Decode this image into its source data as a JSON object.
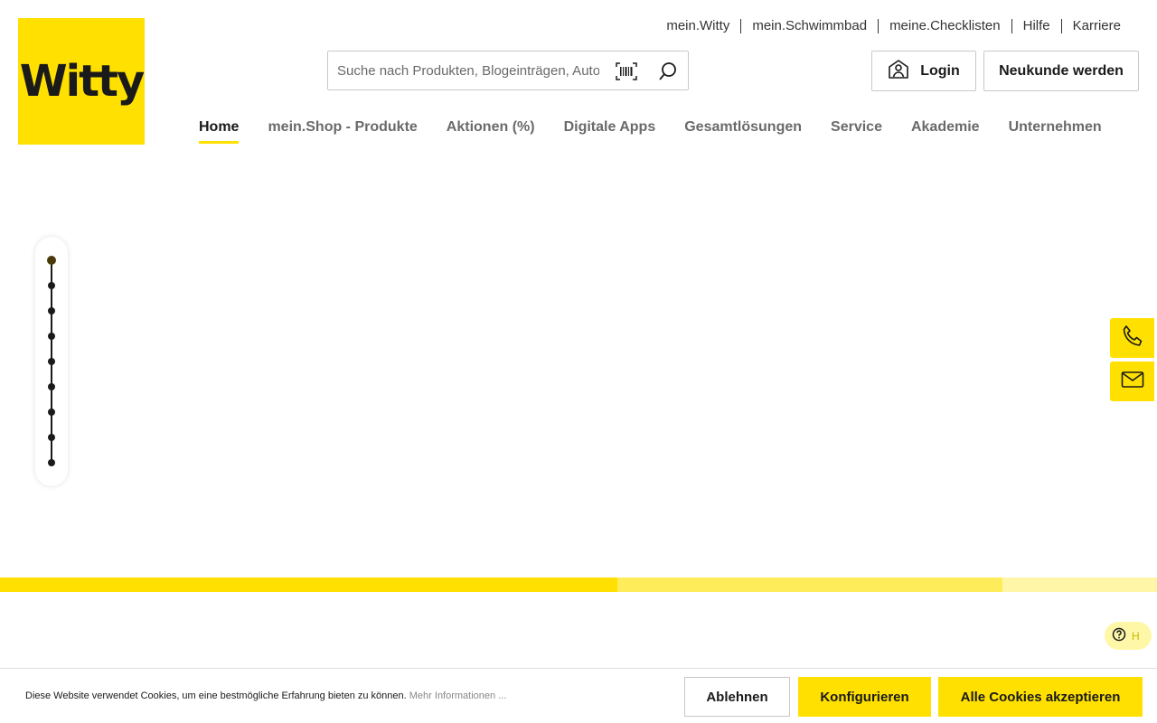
{
  "brand": {
    "logo_text": "Witty",
    "accent_color": "#ffe000"
  },
  "top_links": [
    "mein.Witty",
    "mein.Schwimmbad",
    "meine.Checklisten",
    "Hilfe",
    "Karriere"
  ],
  "search": {
    "placeholder": "Suche nach Produkten, Blogeinträgen, Auto",
    "barcode_icon": "barcode-icon",
    "search_icon": "search-icon"
  },
  "account": {
    "login_label": "Login",
    "register_label": "Neukunde werden",
    "login_icon": "user-house-icon"
  },
  "main_nav": {
    "items": [
      "Home",
      "mein.Shop - Produkte",
      "Aktionen (%)",
      "Digitale Apps",
      "Gesamtlösungen",
      "Service",
      "Akademie",
      "Unternehmen"
    ],
    "active_index": 0
  },
  "slider": {
    "dot_count": 9,
    "active_index": 0
  },
  "side_contacts": [
    "phone-icon",
    "mail-icon"
  ],
  "stripe_colors": [
    "#ffe000",
    "#ffec5a",
    "#fff6a8"
  ],
  "help_chip": {
    "label": "H",
    "icon": "question-circle-icon"
  },
  "cookie_banner": {
    "text": "Diese Website verwendet Cookies, um eine bestmögliche Erfahrung bieten zu können.",
    "more_link": "Mehr Informationen ...",
    "deny_label": "Ablehnen",
    "configure_label": "Konfigurieren",
    "accept_label": "Alle Cookies akzeptieren"
  }
}
